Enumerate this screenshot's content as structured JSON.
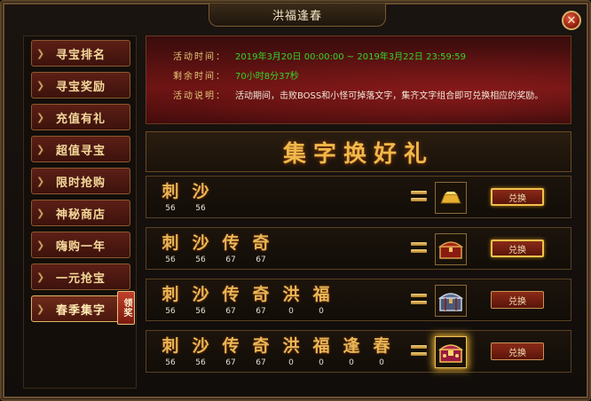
{
  "window": {
    "title": "洪福逢春"
  },
  "sidebar": {
    "items": [
      {
        "label": "寻宝排名"
      },
      {
        "label": "寻宝奖励"
      },
      {
        "label": "充值有礼"
      },
      {
        "label": "超值寻宝"
      },
      {
        "label": "限时抢购"
      },
      {
        "label": "神秘商店"
      },
      {
        "label": "嗨购一年"
      },
      {
        "label": "一元抢宝"
      },
      {
        "label": "春季集字",
        "badge": "领奖",
        "active": true
      }
    ]
  },
  "banner": {
    "time_label": "活动时间：",
    "time_value": "2019年3月20日 00:00:00 ~ 2019年3月22日 23:59:59",
    "remain_label": "剩余时间：",
    "remain_value": "70小时8分37秒",
    "desc_label": "活动说明：",
    "desc_value": "活动期间，击败BOSS和小怪可掉落文字，集齐文字组合即可兑换相应的奖励。"
  },
  "heading": "集字换好礼",
  "exchange_rows": [
    {
      "chars": [
        {
          "char": "刺",
          "count": "56"
        },
        {
          "char": "沙",
          "count": "56"
        }
      ],
      "reward_icon": "gold-bar-icon",
      "button": "兑换"
    },
    {
      "chars": [
        {
          "char": "刺",
          "count": "56"
        },
        {
          "char": "沙",
          "count": "56"
        },
        {
          "char": "传",
          "count": "67"
        },
        {
          "char": "奇",
          "count": "67"
        }
      ],
      "reward_icon": "red-chest-icon",
      "button": "兑换"
    },
    {
      "chars": [
        {
          "char": "刺",
          "count": "56"
        },
        {
          "char": "沙",
          "count": "56"
        },
        {
          "char": "传",
          "count": "67"
        },
        {
          "char": "奇",
          "count": "67"
        },
        {
          "char": "洪",
          "count": "0"
        },
        {
          "char": "福",
          "count": "0"
        }
      ],
      "reward_icon": "silver-chest-icon",
      "button": "兑换"
    },
    {
      "chars": [
        {
          "char": "刺",
          "count": "56"
        },
        {
          "char": "沙",
          "count": "56"
        },
        {
          "char": "传",
          "count": "67"
        },
        {
          "char": "奇",
          "count": "67"
        },
        {
          "char": "洪",
          "count": "0"
        },
        {
          "char": "福",
          "count": "0"
        },
        {
          "char": "逢",
          "count": "0"
        },
        {
          "char": "春",
          "count": "0"
        }
      ],
      "reward_icon": "golden-chest-icon",
      "button": "兑换"
    }
  ]
}
